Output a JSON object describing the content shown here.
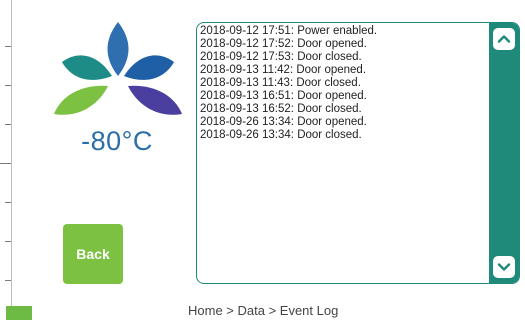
{
  "temperature": "-80°C",
  "back_label": "Back",
  "breadcrumb": "Home > Data > Event Log",
  "event_log": [
    "2018-09-12 17:51: Power enabled.",
    "2018-09-12 17:52: Door opened.",
    "2018-09-12 17:53: Door closed.",
    "2018-09-13 11:42: Door opened.",
    "2018-09-13 11:43: Door closed.",
    "2018-09-13 16:51: Door opened.",
    "2018-09-13 16:52: Door closed.",
    "2018-09-26 13:34: Door opened.",
    "2018-09-26 13:34: Door closed."
  ],
  "icons": {
    "scroll_up": "chevron-up-icon",
    "scroll_down": "chevron-down-icon",
    "logo": "leaf-logo"
  },
  "colors": {
    "accent_teal": "#1f8a7a",
    "button_green": "#7cc142",
    "temp_blue": "#2c6fa8"
  }
}
